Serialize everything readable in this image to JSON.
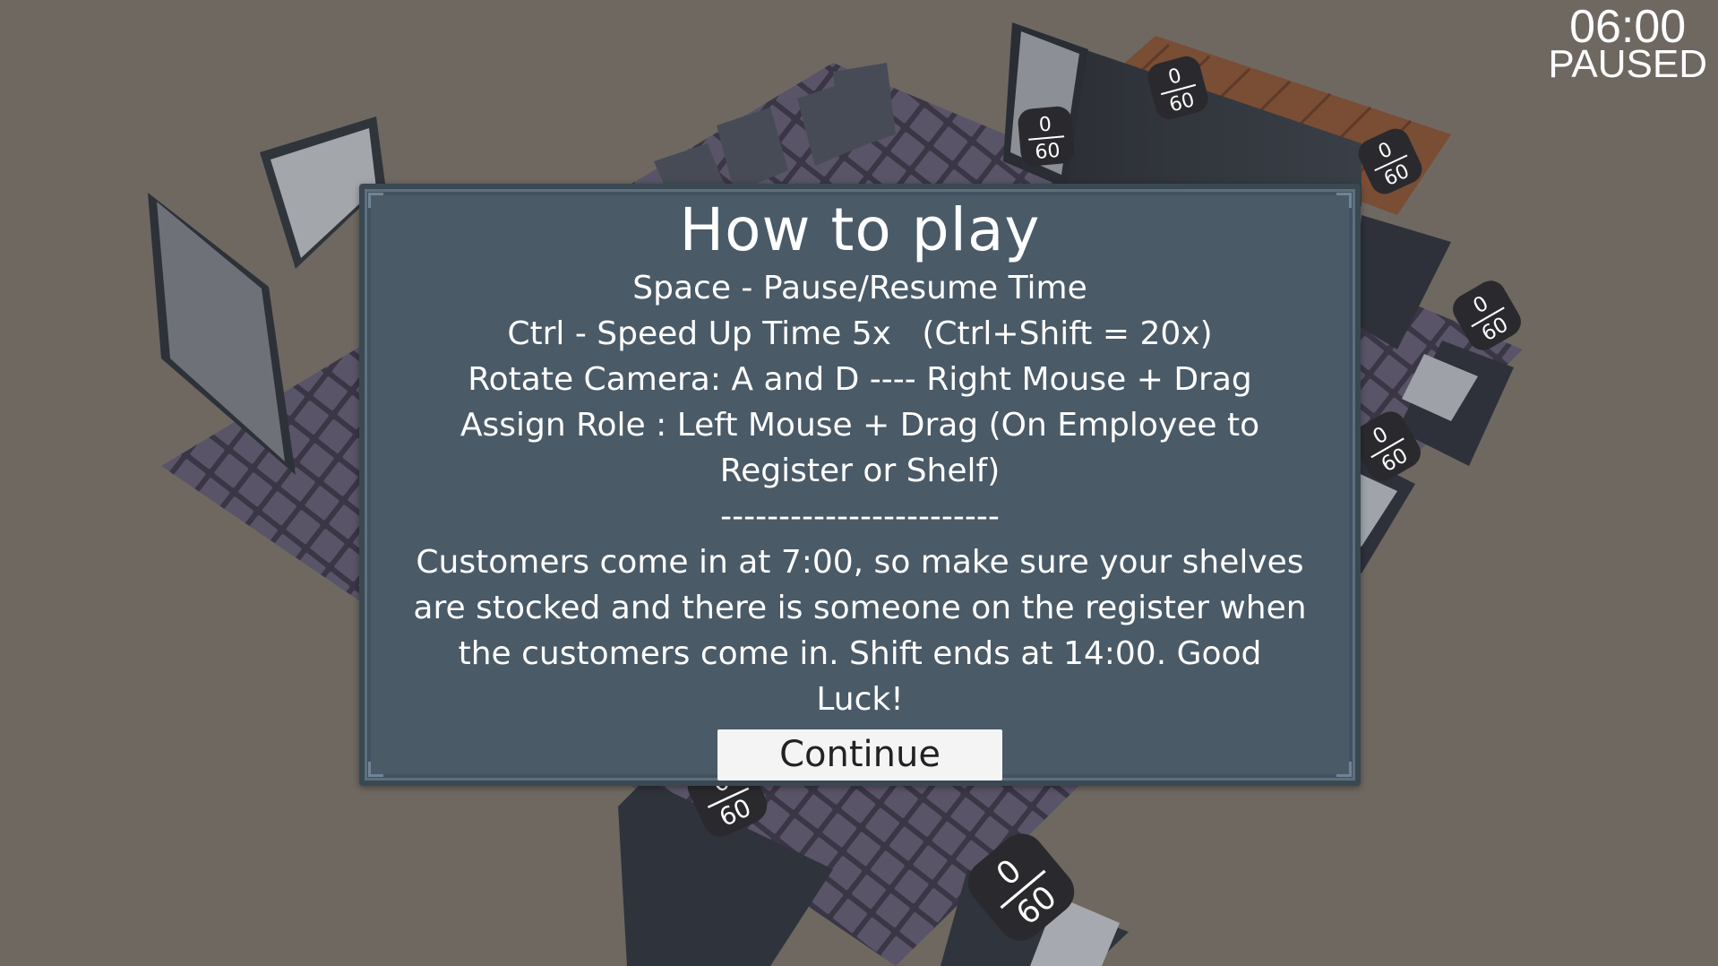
{
  "hud": {
    "time": "06:00",
    "state": "PAUSED"
  },
  "badges": [
    {
      "current": "0",
      "max": "60"
    },
    {
      "current": "0",
      "max": "60"
    },
    {
      "current": "0",
      "max": "60"
    },
    {
      "current": "0",
      "max": "60"
    },
    {
      "current": "0",
      "max": "60"
    },
    {
      "current": "0",
      "max": "60"
    },
    {
      "current": "0",
      "max": "60"
    }
  ],
  "dialog": {
    "title": "How to play",
    "lines": [
      "Space - Pause/Resume Time",
      "Ctrl - Speed Up Time 5x   (Ctrl+Shift = 20x)",
      "Rotate Camera: A and D ---- Right Mouse + Drag"
    ],
    "assign": "Assign Role : Left Mouse + Drag (On Employee to Register or Shelf)",
    "separator": "------------------------",
    "info": "Customers come in at 7:00, so make sure your shelves are stocked and there is someone on the register when the customers come in. Shift ends at 14:00. Good Luck!",
    "continue_label": "Continue"
  },
  "colors": {
    "background": "#6e6861",
    "panel": "#4a5a67",
    "floor": "#4f4a5c",
    "button": "#f4f4f4"
  }
}
